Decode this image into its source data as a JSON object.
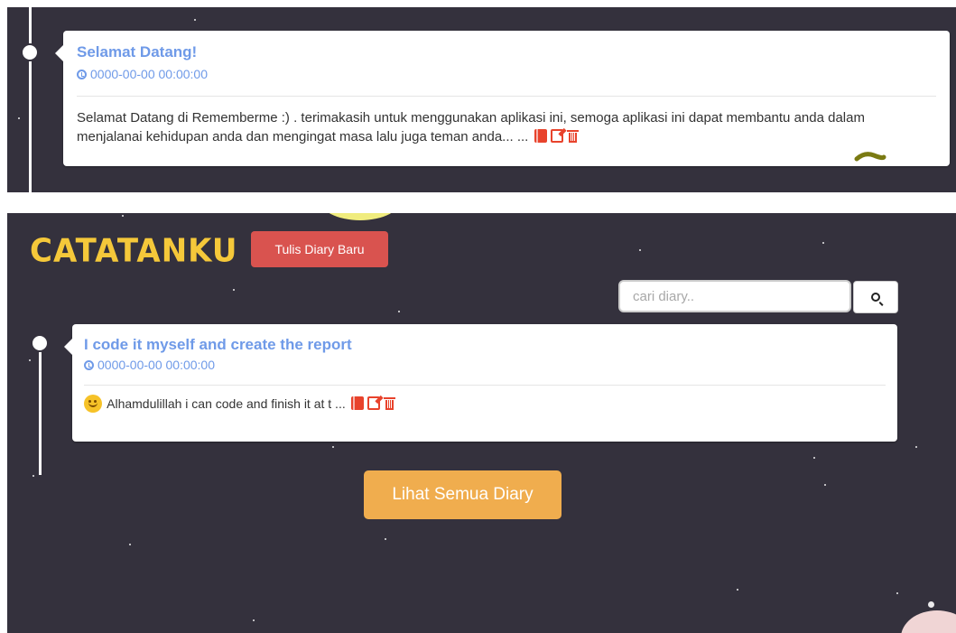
{
  "top_entry": {
    "title": "Selamat Datang!",
    "date": "0000-00-00 00:00:00",
    "body": "Selamat Datang di Rememberme :) . terimakasih untuk menggunakan aplikasi ini, semoga aplikasi ini dapat membantu anda dalam menjalanai kehidupan anda dan mengingat masa lalu juga teman anda... ..."
  },
  "header": {
    "logo": "CATATANKU",
    "new_diary_button": "Tulis Diary Baru"
  },
  "search": {
    "placeholder": "cari diary.."
  },
  "bottom_entry": {
    "title": "I code it myself and create the report",
    "date": "0000-00-00 00:00:00",
    "body": "Alhamdulillah i can code and finish it at t ..."
  },
  "footer": {
    "view_all_button": "Lihat Semua Diary"
  },
  "colors": {
    "background": "#34313d",
    "title_blue": "#6f9ae8",
    "danger_red": "#d9534f",
    "warning_orange": "#f0ad4e",
    "logo_yellow": "#f5c83a"
  },
  "icons": [
    "clock-icon",
    "book-icon",
    "edit-icon",
    "trash-icon",
    "search-icon",
    "smiley-icon"
  ]
}
